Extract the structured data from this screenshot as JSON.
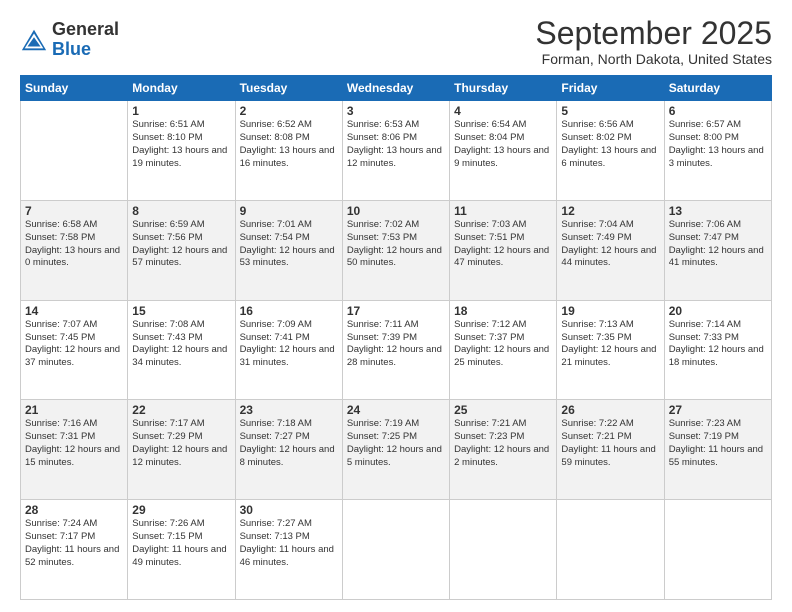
{
  "logo": {
    "general": "General",
    "blue": "Blue"
  },
  "title": "September 2025",
  "subtitle": "Forman, North Dakota, United States",
  "weekdays": [
    "Sunday",
    "Monday",
    "Tuesday",
    "Wednesday",
    "Thursday",
    "Friday",
    "Saturday"
  ],
  "weeks": [
    [
      {
        "day": "",
        "sunrise": "",
        "sunset": "",
        "daylight": ""
      },
      {
        "day": "1",
        "sunrise": "Sunrise: 6:51 AM",
        "sunset": "Sunset: 8:10 PM",
        "daylight": "Daylight: 13 hours and 19 minutes."
      },
      {
        "day": "2",
        "sunrise": "Sunrise: 6:52 AM",
        "sunset": "Sunset: 8:08 PM",
        "daylight": "Daylight: 13 hours and 16 minutes."
      },
      {
        "day": "3",
        "sunrise": "Sunrise: 6:53 AM",
        "sunset": "Sunset: 8:06 PM",
        "daylight": "Daylight: 13 hours and 12 minutes."
      },
      {
        "day": "4",
        "sunrise": "Sunrise: 6:54 AM",
        "sunset": "Sunset: 8:04 PM",
        "daylight": "Daylight: 13 hours and 9 minutes."
      },
      {
        "day": "5",
        "sunrise": "Sunrise: 6:56 AM",
        "sunset": "Sunset: 8:02 PM",
        "daylight": "Daylight: 13 hours and 6 minutes."
      },
      {
        "day": "6",
        "sunrise": "Sunrise: 6:57 AM",
        "sunset": "Sunset: 8:00 PM",
        "daylight": "Daylight: 13 hours and 3 minutes."
      }
    ],
    [
      {
        "day": "7",
        "sunrise": "Sunrise: 6:58 AM",
        "sunset": "Sunset: 7:58 PM",
        "daylight": "Daylight: 13 hours and 0 minutes."
      },
      {
        "day": "8",
        "sunrise": "Sunrise: 6:59 AM",
        "sunset": "Sunset: 7:56 PM",
        "daylight": "Daylight: 12 hours and 57 minutes."
      },
      {
        "day": "9",
        "sunrise": "Sunrise: 7:01 AM",
        "sunset": "Sunset: 7:54 PM",
        "daylight": "Daylight: 12 hours and 53 minutes."
      },
      {
        "day": "10",
        "sunrise": "Sunrise: 7:02 AM",
        "sunset": "Sunset: 7:53 PM",
        "daylight": "Daylight: 12 hours and 50 minutes."
      },
      {
        "day": "11",
        "sunrise": "Sunrise: 7:03 AM",
        "sunset": "Sunset: 7:51 PM",
        "daylight": "Daylight: 12 hours and 47 minutes."
      },
      {
        "day": "12",
        "sunrise": "Sunrise: 7:04 AM",
        "sunset": "Sunset: 7:49 PM",
        "daylight": "Daylight: 12 hours and 44 minutes."
      },
      {
        "day": "13",
        "sunrise": "Sunrise: 7:06 AM",
        "sunset": "Sunset: 7:47 PM",
        "daylight": "Daylight: 12 hours and 41 minutes."
      }
    ],
    [
      {
        "day": "14",
        "sunrise": "Sunrise: 7:07 AM",
        "sunset": "Sunset: 7:45 PM",
        "daylight": "Daylight: 12 hours and 37 minutes."
      },
      {
        "day": "15",
        "sunrise": "Sunrise: 7:08 AM",
        "sunset": "Sunset: 7:43 PM",
        "daylight": "Daylight: 12 hours and 34 minutes."
      },
      {
        "day": "16",
        "sunrise": "Sunrise: 7:09 AM",
        "sunset": "Sunset: 7:41 PM",
        "daylight": "Daylight: 12 hours and 31 minutes."
      },
      {
        "day": "17",
        "sunrise": "Sunrise: 7:11 AM",
        "sunset": "Sunset: 7:39 PM",
        "daylight": "Daylight: 12 hours and 28 minutes."
      },
      {
        "day": "18",
        "sunrise": "Sunrise: 7:12 AM",
        "sunset": "Sunset: 7:37 PM",
        "daylight": "Daylight: 12 hours and 25 minutes."
      },
      {
        "day": "19",
        "sunrise": "Sunrise: 7:13 AM",
        "sunset": "Sunset: 7:35 PM",
        "daylight": "Daylight: 12 hours and 21 minutes."
      },
      {
        "day": "20",
        "sunrise": "Sunrise: 7:14 AM",
        "sunset": "Sunset: 7:33 PM",
        "daylight": "Daylight: 12 hours and 18 minutes."
      }
    ],
    [
      {
        "day": "21",
        "sunrise": "Sunrise: 7:16 AM",
        "sunset": "Sunset: 7:31 PM",
        "daylight": "Daylight: 12 hours and 15 minutes."
      },
      {
        "day": "22",
        "sunrise": "Sunrise: 7:17 AM",
        "sunset": "Sunset: 7:29 PM",
        "daylight": "Daylight: 12 hours and 12 minutes."
      },
      {
        "day": "23",
        "sunrise": "Sunrise: 7:18 AM",
        "sunset": "Sunset: 7:27 PM",
        "daylight": "Daylight: 12 hours and 8 minutes."
      },
      {
        "day": "24",
        "sunrise": "Sunrise: 7:19 AM",
        "sunset": "Sunset: 7:25 PM",
        "daylight": "Daylight: 12 hours and 5 minutes."
      },
      {
        "day": "25",
        "sunrise": "Sunrise: 7:21 AM",
        "sunset": "Sunset: 7:23 PM",
        "daylight": "Daylight: 12 hours and 2 minutes."
      },
      {
        "day": "26",
        "sunrise": "Sunrise: 7:22 AM",
        "sunset": "Sunset: 7:21 PM",
        "daylight": "Daylight: 11 hours and 59 minutes."
      },
      {
        "day": "27",
        "sunrise": "Sunrise: 7:23 AM",
        "sunset": "Sunset: 7:19 PM",
        "daylight": "Daylight: 11 hours and 55 minutes."
      }
    ],
    [
      {
        "day": "28",
        "sunrise": "Sunrise: 7:24 AM",
        "sunset": "Sunset: 7:17 PM",
        "daylight": "Daylight: 11 hours and 52 minutes."
      },
      {
        "day": "29",
        "sunrise": "Sunrise: 7:26 AM",
        "sunset": "Sunset: 7:15 PM",
        "daylight": "Daylight: 11 hours and 49 minutes."
      },
      {
        "day": "30",
        "sunrise": "Sunrise: 7:27 AM",
        "sunset": "Sunset: 7:13 PM",
        "daylight": "Daylight: 11 hours and 46 minutes."
      },
      {
        "day": "",
        "sunrise": "",
        "sunset": "",
        "daylight": ""
      },
      {
        "day": "",
        "sunrise": "",
        "sunset": "",
        "daylight": ""
      },
      {
        "day": "",
        "sunrise": "",
        "sunset": "",
        "daylight": ""
      },
      {
        "day": "",
        "sunrise": "",
        "sunset": "",
        "daylight": ""
      }
    ]
  ]
}
